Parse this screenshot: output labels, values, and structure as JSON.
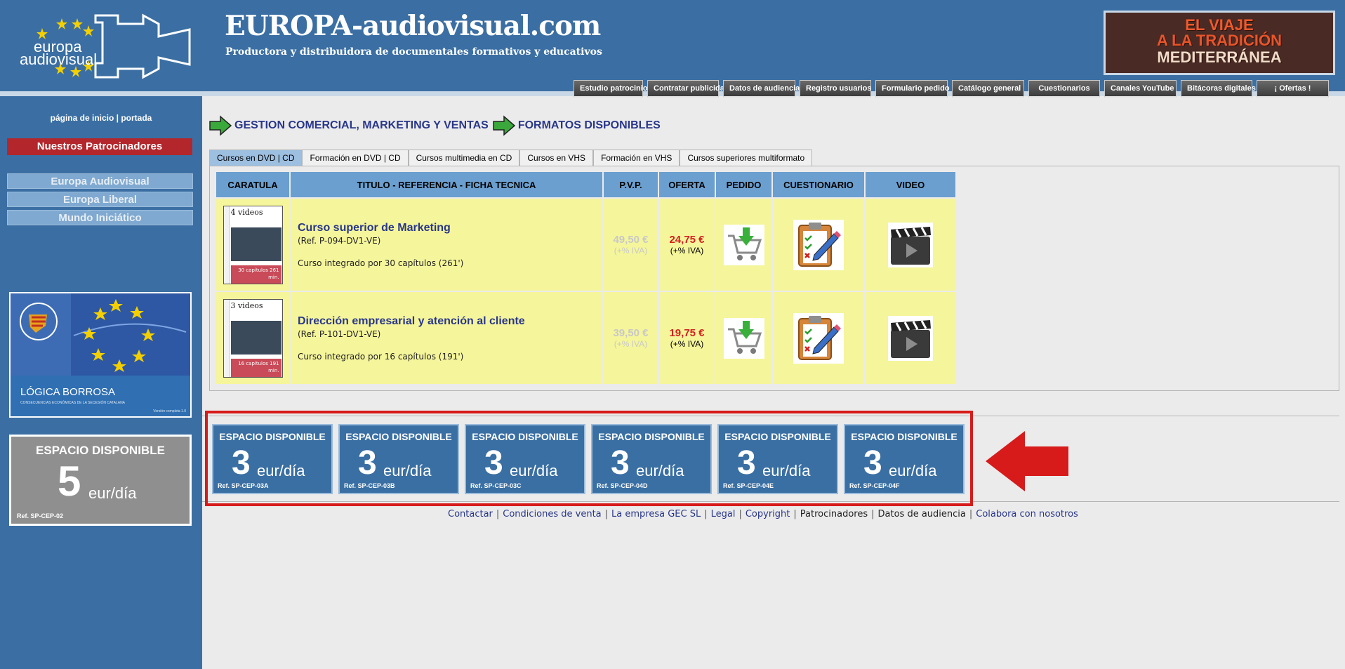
{
  "header": {
    "logo_line1": "europa",
    "logo_line2": "audiovisual",
    "title": "EUROPA-audiovisual.com",
    "subtitle": "Productora y distribuidora de documentales formativos y educativos",
    "banner": {
      "line1": "EL VIAJE",
      "line2": "A LA TRADICIÓN",
      "line3": "MEDITERRÁNEA"
    }
  },
  "topnav": [
    "Estudio patrocinios",
    "Contratar publicidad",
    "Datos de audiencia",
    "Registro usuarios",
    "Formulario pedido",
    "Catálogo general",
    "Cuestionarios",
    "Canales YouTube",
    "Bitácoras digitales",
    "¡ Ofertas !"
  ],
  "sidebar": {
    "home": "página de inicio | portada",
    "sponsors": "Nuestros Patrocinadores",
    "links": [
      "Europa Audiovisual",
      "Europa Liberal",
      "Mundo Iniciático"
    ],
    "ad1": {
      "title": "LÓGICA BORROSA",
      "subtitle": "CONSECUENCIAS ECONÓMICAS DE LA SECESIÓN CATALANA",
      "version": "Versión completa 1.0"
    },
    "ad2": {
      "title": "ESPACIO DISPONIBLE",
      "number": "5",
      "unit": "eur/día",
      "ref": "Ref. SP-CEP-02"
    }
  },
  "breadcrumb": [
    "GESTION COMERCIAL, MARKETING Y VENTAS",
    "FORMATOS DISPONIBLES"
  ],
  "tabs": [
    "Cursos en DVD | CD",
    "Formación en DVD | CD",
    "Cursos multimedia en CD",
    "Cursos en VHS",
    "Formación en VHS",
    "Cursos superiores multiformato"
  ],
  "table": {
    "headers": [
      "CARATULA",
      "TITULO - REFERENCIA - FICHA TECNICA",
      "P.V.P.",
      "OFERTA",
      "PEDIDO",
      "CUESTIONARIO",
      "VIDEO"
    ],
    "rows": [
      {
        "cover_head": "4 videos",
        "cover_foot": "30 capítulos 261 min.",
        "title": "Curso superior de Marketing",
        "ref": "(Ref. P-094-DV1-VE)",
        "desc": "Curso integrado por 30 capítulos (261')",
        "pvp": "49,50 €",
        "pvp_tax": "(+% IVA)",
        "oferta": "24,75 €",
        "oferta_tax": "(+% IVA)"
      },
      {
        "cover_head": "3 videos",
        "cover_foot": "16 capítulos 191 min.",
        "title": "Dirección empresarial y atención al cliente",
        "ref": "(Ref. P-101-DV1-VE)",
        "desc": "Curso integrado por 16 capítulos (191')",
        "pvp": "39,50 €",
        "pvp_tax": "(+% IVA)",
        "oferta": "19,75 €",
        "oferta_tax": "(+% IVA)"
      }
    ]
  },
  "ads": [
    {
      "title": "ESPACIO DISPONIBLE",
      "number": "3",
      "unit": "eur/día",
      "ref": "Ref. SP-CEP-03A"
    },
    {
      "title": "ESPACIO DISPONIBLE",
      "number": "3",
      "unit": "eur/día",
      "ref": "Ref. SP-CEP-03B"
    },
    {
      "title": "ESPACIO DISPONIBLE",
      "number": "3",
      "unit": "eur/día",
      "ref": "Ref. SP-CEP-03C"
    },
    {
      "title": "ESPACIO DISPONIBLE",
      "number": "3",
      "unit": "eur/día",
      "ref": "Ref. SP-CEP-04D"
    },
    {
      "title": "ESPACIO DISPONIBLE",
      "number": "3",
      "unit": "eur/día",
      "ref": "Ref. SP-CEP-04E"
    },
    {
      "title": "ESPACIO DISPONIBLE",
      "number": "3",
      "unit": "eur/día",
      "ref": "Ref. SP-CEP-04F"
    }
  ],
  "footer": {
    "contactar": "Contactar",
    "condiciones": "Condiciones de venta",
    "empresa": "La empresa GEC SL",
    "legal": "Legal",
    "copyright": "Copyright",
    "patrocinadores": "Patrocinadores",
    "audiencia": "Datos de audiencia",
    "colabora": "Colabora con nosotros",
    "separator": "|"
  },
  "colors": {
    "header_blue": "#3b6fa3",
    "title_blue": "#29378a",
    "offer_red": "#d51f1f",
    "row_yellow": "#f5f59c",
    "highlight_red": "#d71a1a"
  },
  "icons": [
    "green-arrow-icon",
    "shopping-cart-icon",
    "clipboard-checklist-icon",
    "video-clapperboard-icon",
    "red-arrow-icon",
    "eu-stars-icon"
  ]
}
